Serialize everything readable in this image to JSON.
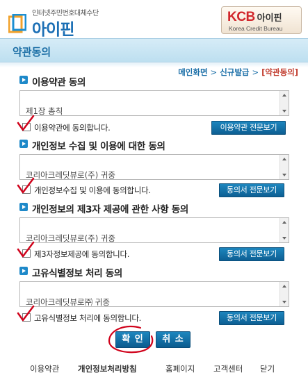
{
  "header": {
    "logo_sub": "인터넷주민번호대체수단",
    "logo_main": "아이핀",
    "kcb_brand": "KCB",
    "kcb_name": "아이핀",
    "kcb_sub": "Korea Credit Bureau"
  },
  "page_title": "약관동의",
  "breadcrumb": {
    "home": "메인화면",
    "step": "신규발급",
    "current": "[약관동의]",
    "sep": ">"
  },
  "sections": [
    {
      "title": "이용약관 동의",
      "preview": "제1장 총칙",
      "agree_label": "이용약관에 동의합니다.",
      "button": "이용약관 전문보기",
      "checked": true
    },
    {
      "title": "개인정보 수집 및 이용에 대한 동의",
      "preview": "코리아크레딧뷰로(주) 귀중",
      "agree_label": "개인정보수집 및 이용에 동의합니다.",
      "button": "동의서 전문보기",
      "checked": true
    },
    {
      "title": "개인정보의 제3자 제공에 관한 사항 동의",
      "preview": "코리아크레딧뷰로(주) 귀중",
      "agree_label": "제3자정보제공에 동의합니다.",
      "button": "동의서 전문보기",
      "checked": true
    },
    {
      "title": "고유식별정보 처리 동의",
      "preview": "코리아크레딧뷰로㈜ 귀중",
      "agree_label": "고유식별정보 처리에 동의합니다.",
      "button": "동의서 전문보기",
      "checked": true
    }
  ],
  "actions": {
    "confirm": "확 인",
    "cancel": "취 소"
  },
  "footer": [
    "이용약관",
    "개인정보처리방침",
    "홈페이지",
    "고객센터",
    "닫기"
  ],
  "colors": {
    "accent": "#1b6fa8",
    "button": "#0d5f93",
    "current": "#c0392b",
    "annotation": "#d0021b"
  }
}
